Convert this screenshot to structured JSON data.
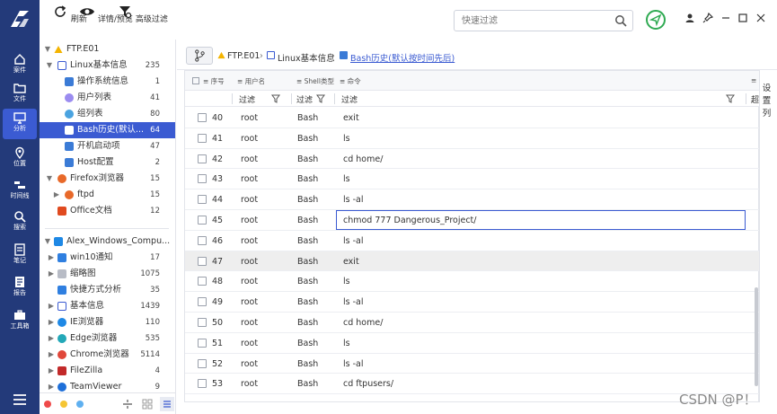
{
  "rail": {
    "items": [
      {
        "label": "案件",
        "icon": "home-icon"
      },
      {
        "label": "文件",
        "icon": "folder-icon"
      },
      {
        "label": "分析",
        "icon": "monitor-icon"
      },
      {
        "label": "位置",
        "icon": "location-icon"
      },
      {
        "label": "时间线",
        "icon": "timeline-icon"
      },
      {
        "label": "搜索",
        "icon": "search-icon"
      },
      {
        "label": "笔记",
        "icon": "note-icon"
      },
      {
        "label": "报告",
        "icon": "report-icon"
      },
      {
        "label": "工具箱",
        "icon": "toolbox-icon"
      }
    ],
    "active_index": 2
  },
  "toolbar": {
    "refresh_label": "刷新",
    "details_label": "详情/预览",
    "advfilter_label": "高级过滤",
    "search_placeholder": "快速过滤"
  },
  "tree": {
    "items": [
      {
        "label": "FTP.E01",
        "count": ""
      },
      {
        "label": "Linux基本信息",
        "count": "235"
      },
      {
        "label": "操作系统信息",
        "count": "1"
      },
      {
        "label": "用户列表",
        "count": "41"
      },
      {
        "label": "组列表",
        "count": "80"
      },
      {
        "label": "Bash历史(默认...",
        "count": "64"
      },
      {
        "label": "开机启动项",
        "count": "47"
      },
      {
        "label": "Host配置",
        "count": "2"
      },
      {
        "label": "Firefox浏览器",
        "count": "15"
      },
      {
        "label": "ftpd",
        "count": "15"
      },
      {
        "label": "Office文档",
        "count": "12"
      },
      {
        "label": "Alex_Windows_Compu...",
        "count": ""
      },
      {
        "label": "win10通知",
        "count": "17"
      },
      {
        "label": "缩略图",
        "count": "1075"
      },
      {
        "label": "快捷方式分析",
        "count": "35"
      },
      {
        "label": "基本信息",
        "count": "1439"
      },
      {
        "label": "IE浏览器",
        "count": "110"
      },
      {
        "label": "Edge浏览器",
        "count": "535"
      },
      {
        "label": "Chrome浏览器",
        "count": "5114"
      },
      {
        "label": "FileZilla",
        "count": "4"
      },
      {
        "label": "TeamViewer",
        "count": "9"
      }
    ],
    "selected_index": 5
  },
  "breadcrumb": {
    "items": [
      "FTP.E01",
      "Linux基本信息",
      "Bash历史(默认按时间先后)"
    ]
  },
  "grid": {
    "headers": {
      "index": "序号",
      "user": "用户名",
      "shell": "Shell类型",
      "command": "命令"
    },
    "filter_label": "过滤",
    "filter_right": "超",
    "rows": [
      {
        "no": "40",
        "user": "root",
        "shell": "Bash",
        "cmd": "exit"
      },
      {
        "no": "41",
        "user": "root",
        "shell": "Bash",
        "cmd": "ls"
      },
      {
        "no": "42",
        "user": "root",
        "shell": "Bash",
        "cmd": "cd home/"
      },
      {
        "no": "43",
        "user": "root",
        "shell": "Bash",
        "cmd": "ls"
      },
      {
        "no": "44",
        "user": "root",
        "shell": "Bash",
        "cmd": "ls -al"
      },
      {
        "no": "45",
        "user": "root",
        "shell": "Bash",
        "cmd": "chmod 777 Dangerous_Project/"
      },
      {
        "no": "46",
        "user": "root",
        "shell": "Bash",
        "cmd": "ls -al"
      },
      {
        "no": "47",
        "user": "root",
        "shell": "Bash",
        "cmd": "exit"
      },
      {
        "no": "48",
        "user": "root",
        "shell": "Bash",
        "cmd": "ls"
      },
      {
        "no": "49",
        "user": "root",
        "shell": "Bash",
        "cmd": "ls -al"
      },
      {
        "no": "50",
        "user": "root",
        "shell": "Bash",
        "cmd": "cd home/"
      },
      {
        "no": "51",
        "user": "root",
        "shell": "Bash",
        "cmd": "ls"
      },
      {
        "no": "52",
        "user": "root",
        "shell": "Bash",
        "cmd": "ls -al"
      },
      {
        "no": "53",
        "user": "root",
        "shell": "Bash",
        "cmd": "cd ftpusers/"
      }
    ],
    "editing_index": 5,
    "highlight_index": 7
  },
  "right_panel": {
    "label1": "设",
    "label2": "置",
    "label3": "列"
  },
  "watermark": "CSDN @P！",
  "colors": {
    "rail": "#233a7a",
    "accent": "#3b5bd2",
    "send": "#2faa52"
  }
}
